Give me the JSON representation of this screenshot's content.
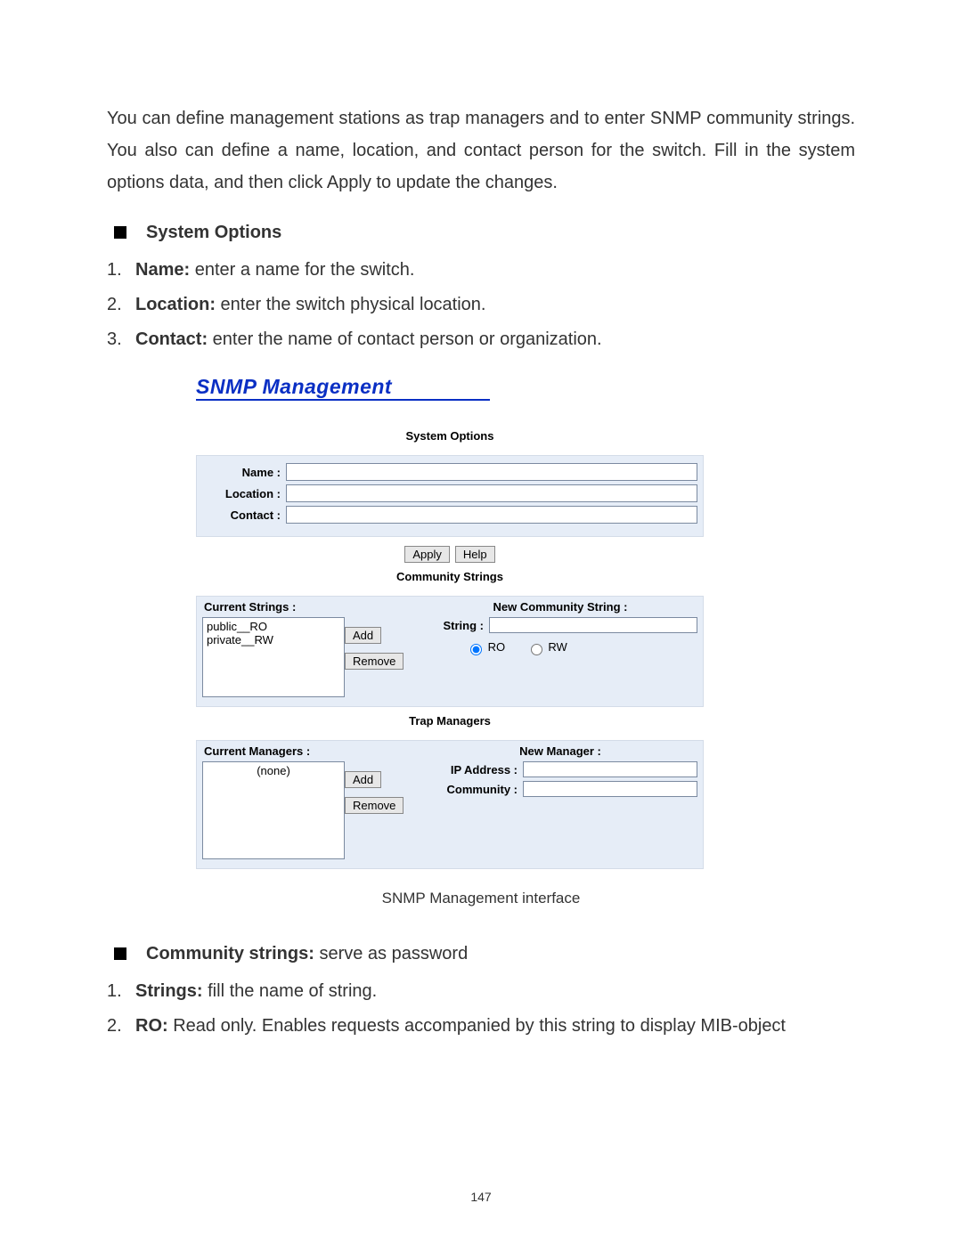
{
  "intro_paragraph": "You can define management stations as trap managers and to enter SNMP community strings. You also can define a name, location, and contact person for the switch. Fill in the system options data, and then click Apply to update the changes.",
  "section1": {
    "title": "System Options",
    "items": [
      {
        "num": "1.",
        "label": "Name:",
        "desc": " enter a name for the switch."
      },
      {
        "num": "2.",
        "label": "Location:",
        "desc": " enter the switch physical location."
      },
      {
        "num": "3.",
        "label": "Contact:",
        "desc": " enter the name of contact person or organization."
      }
    ]
  },
  "screenshot": {
    "heading": "SNMP Management",
    "caption": "SNMP Management interface",
    "system_options": {
      "title": "System Options",
      "name_label": "Name :",
      "location_label": "Location :",
      "contact_label": "Contact :",
      "name_value": "",
      "location_value": "",
      "contact_value": "",
      "apply": "Apply",
      "help": "Help"
    },
    "community": {
      "title": "Community Strings",
      "current_label": "Current Strings :",
      "new_label": "New Community String :",
      "list_text": "public__RO\nprivate__RW",
      "add": "Add",
      "remove": "Remove",
      "string_label": "String :",
      "string_value": "",
      "ro_label": "RO",
      "rw_label": "RW",
      "ro_checked": true,
      "rw_checked": false
    },
    "trap": {
      "title": "Trap Managers",
      "current_label": "Current Managers :",
      "new_label": "New Manager :",
      "list_text": "(none)",
      "add": "Add",
      "remove": "Remove",
      "ip_label": "IP Address :",
      "ip_value": "",
      "community_label": "Community :",
      "community_value": ""
    }
  },
  "section2": {
    "title": "Community strings:",
    "title_tail": " serve as password",
    "items": [
      {
        "num": "1.",
        "label": "Strings:",
        "desc": " fill the name of string."
      },
      {
        "num": "2.",
        "label": "RO:",
        "desc": " Read only. Enables requests accompanied by this string to display MIB-object"
      }
    ]
  },
  "page_number": "147"
}
